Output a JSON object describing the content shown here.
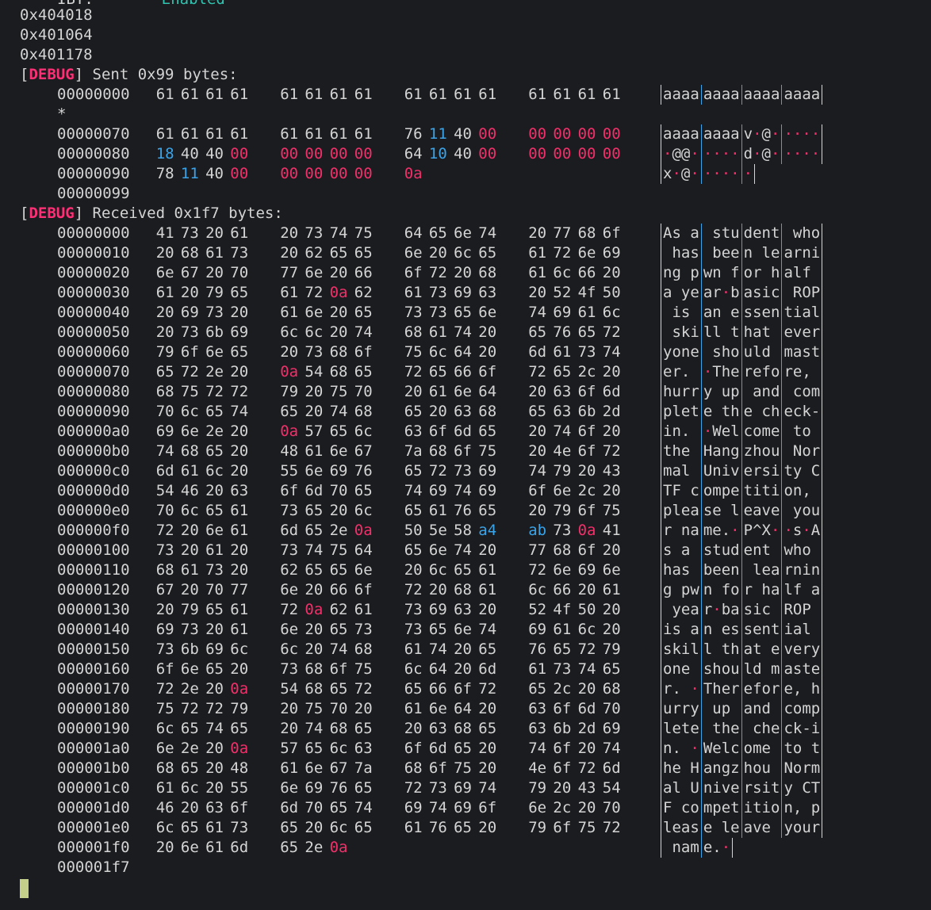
{
  "top_partial": {
    "label": "IBT:",
    "value": "Enabled"
  },
  "addresses": [
    "0x404018",
    "0x401064",
    "0x401178"
  ],
  "sent_block": {
    "tag": "DEBUG",
    "message": " Sent 0x99 bytes:",
    "rows": [
      {
        "off": "00000000",
        "bytes": [
          "61",
          "61",
          "61",
          "61",
          "61",
          "61",
          "61",
          "61",
          "61",
          "61",
          "61",
          "61",
          "61",
          "61",
          "61",
          "61"
        ],
        "ascii": [
          "aaaa",
          "aaaa",
          "aaaa",
          "aaaa"
        ]
      },
      {
        "off": "*",
        "bytes": [],
        "ascii": []
      },
      {
        "off": "00000070",
        "bytes": [
          "61",
          "61",
          "61",
          "61",
          "61",
          "61",
          "61",
          "61",
          "76",
          "11",
          "40",
          "00",
          "00",
          "00",
          "00",
          "00"
        ],
        "ascii": [
          "aaaa",
          "aaaa",
          "v·@·",
          "····"
        ]
      },
      {
        "off": "00000080",
        "bytes": [
          "18",
          "40",
          "40",
          "00",
          "00",
          "00",
          "00",
          "00",
          "64",
          "10",
          "40",
          "00",
          "00",
          "00",
          "00",
          "00"
        ],
        "ascii": [
          "·@@·",
          "····",
          "d·@·",
          "····"
        ]
      },
      {
        "off": "00000090",
        "bytes": [
          "78",
          "11",
          "40",
          "00",
          "00",
          "00",
          "00",
          "00",
          "0a"
        ],
        "ascii": [
          "x·@·",
          "····",
          "·"
        ]
      },
      {
        "off": "00000099",
        "bytes": [],
        "ascii": []
      }
    ]
  },
  "recv_block": {
    "tag": "DEBUG",
    "message": " Received 0x1f7 bytes:",
    "rows": [
      {
        "off": "00000000",
        "bytes": [
          "41",
          "73",
          "20",
          "61",
          "20",
          "73",
          "74",
          "75",
          "64",
          "65",
          "6e",
          "74",
          "20",
          "77",
          "68",
          "6f"
        ],
        "ascii": [
          "As a",
          " stu",
          "dent",
          " who"
        ]
      },
      {
        "off": "00000010",
        "bytes": [
          "20",
          "68",
          "61",
          "73",
          "20",
          "62",
          "65",
          "65",
          "6e",
          "20",
          "6c",
          "65",
          "61",
          "72",
          "6e",
          "69"
        ],
        "ascii": [
          " has",
          " bee",
          "n le",
          "arni"
        ]
      },
      {
        "off": "00000020",
        "bytes": [
          "6e",
          "67",
          "20",
          "70",
          "77",
          "6e",
          "20",
          "66",
          "6f",
          "72",
          "20",
          "68",
          "61",
          "6c",
          "66",
          "20"
        ],
        "ascii": [
          "ng p",
          "wn f",
          "or h",
          "alf "
        ]
      },
      {
        "off": "00000030",
        "bytes": [
          "61",
          "20",
          "79",
          "65",
          "61",
          "72",
          "0a",
          "62",
          "61",
          "73",
          "69",
          "63",
          "20",
          "52",
          "4f",
          "50"
        ],
        "ascii": [
          "a ye",
          "ar·b",
          "asic",
          " ROP"
        ]
      },
      {
        "off": "00000040",
        "bytes": [
          "20",
          "69",
          "73",
          "20",
          "61",
          "6e",
          "20",
          "65",
          "73",
          "73",
          "65",
          "6e",
          "74",
          "69",
          "61",
          "6c"
        ],
        "ascii": [
          " is ",
          "an e",
          "ssen",
          "tial"
        ]
      },
      {
        "off": "00000050",
        "bytes": [
          "20",
          "73",
          "6b",
          "69",
          "6c",
          "6c",
          "20",
          "74",
          "68",
          "61",
          "74",
          "20",
          "65",
          "76",
          "65",
          "72"
        ],
        "ascii": [
          " ski",
          "ll t",
          "hat ",
          "ever"
        ]
      },
      {
        "off": "00000060",
        "bytes": [
          "79",
          "6f",
          "6e",
          "65",
          "20",
          "73",
          "68",
          "6f",
          "75",
          "6c",
          "64",
          "20",
          "6d",
          "61",
          "73",
          "74"
        ],
        "ascii": [
          "yone",
          " sho",
          "uld ",
          "mast"
        ]
      },
      {
        "off": "00000070",
        "bytes": [
          "65",
          "72",
          "2e",
          "20",
          "0a",
          "54",
          "68",
          "65",
          "72",
          "65",
          "66",
          "6f",
          "72",
          "65",
          "2c",
          "20"
        ],
        "ascii": [
          "er. ",
          "·The",
          "refo",
          "re, "
        ]
      },
      {
        "off": "00000080",
        "bytes": [
          "68",
          "75",
          "72",
          "72",
          "79",
          "20",
          "75",
          "70",
          "20",
          "61",
          "6e",
          "64",
          "20",
          "63",
          "6f",
          "6d"
        ],
        "ascii": [
          "hurr",
          "y up",
          " and",
          " com"
        ]
      },
      {
        "off": "00000090",
        "bytes": [
          "70",
          "6c",
          "65",
          "74",
          "65",
          "20",
          "74",
          "68",
          "65",
          "20",
          "63",
          "68",
          "65",
          "63",
          "6b",
          "2d"
        ],
        "ascii": [
          "plet",
          "e th",
          "e ch",
          "eck-"
        ]
      },
      {
        "off": "000000a0",
        "bytes": [
          "69",
          "6e",
          "2e",
          "20",
          "0a",
          "57",
          "65",
          "6c",
          "63",
          "6f",
          "6d",
          "65",
          "20",
          "74",
          "6f",
          "20"
        ],
        "ascii": [
          "in. ",
          "·Wel",
          "come",
          " to "
        ]
      },
      {
        "off": "000000b0",
        "bytes": [
          "74",
          "68",
          "65",
          "20",
          "48",
          "61",
          "6e",
          "67",
          "7a",
          "68",
          "6f",
          "75",
          "20",
          "4e",
          "6f",
          "72"
        ],
        "ascii": [
          "the ",
          "Hang",
          "zhou",
          " Nor"
        ]
      },
      {
        "off": "000000c0",
        "bytes": [
          "6d",
          "61",
          "6c",
          "20",
          "55",
          "6e",
          "69",
          "76",
          "65",
          "72",
          "73",
          "69",
          "74",
          "79",
          "20",
          "43"
        ],
        "ascii": [
          "mal ",
          "Univ",
          "ersi",
          "ty C"
        ]
      },
      {
        "off": "000000d0",
        "bytes": [
          "54",
          "46",
          "20",
          "63",
          "6f",
          "6d",
          "70",
          "65",
          "74",
          "69",
          "74",
          "69",
          "6f",
          "6e",
          "2c",
          "20"
        ],
        "ascii": [
          "TF c",
          "ompe",
          "titi",
          "on, "
        ]
      },
      {
        "off": "000000e0",
        "bytes": [
          "70",
          "6c",
          "65",
          "61",
          "73",
          "65",
          "20",
          "6c",
          "65",
          "61",
          "76",
          "65",
          "20",
          "79",
          "6f",
          "75"
        ],
        "ascii": [
          "plea",
          "se l",
          "eave",
          " you"
        ]
      },
      {
        "off": "000000f0",
        "bytes": [
          "72",
          "20",
          "6e",
          "61",
          "6d",
          "65",
          "2e",
          "0a",
          "50",
          "5e",
          "58",
          "a4",
          "ab",
          "73",
          "0a",
          "41"
        ],
        "ascii": [
          "r na",
          "me.·",
          "P^X·",
          "·s·A"
        ]
      },
      {
        "off": "00000100",
        "bytes": [
          "73",
          "20",
          "61",
          "20",
          "73",
          "74",
          "75",
          "64",
          "65",
          "6e",
          "74",
          "20",
          "77",
          "68",
          "6f",
          "20"
        ],
        "ascii": [
          "s a ",
          "stud",
          "ent ",
          "who "
        ]
      },
      {
        "off": "00000110",
        "bytes": [
          "68",
          "61",
          "73",
          "20",
          "62",
          "65",
          "65",
          "6e",
          "20",
          "6c",
          "65",
          "61",
          "72",
          "6e",
          "69",
          "6e"
        ],
        "ascii": [
          "has ",
          "been",
          " lea",
          "rnin"
        ]
      },
      {
        "off": "00000120",
        "bytes": [
          "67",
          "20",
          "70",
          "77",
          "6e",
          "20",
          "66",
          "6f",
          "72",
          "20",
          "68",
          "61",
          "6c",
          "66",
          "20",
          "61"
        ],
        "ascii": [
          "g pw",
          "n fo",
          "r ha",
          "lf a"
        ]
      },
      {
        "off": "00000130",
        "bytes": [
          "20",
          "79",
          "65",
          "61",
          "72",
          "0a",
          "62",
          "61",
          "73",
          "69",
          "63",
          "20",
          "52",
          "4f",
          "50",
          "20"
        ],
        "ascii": [
          " yea",
          "r·ba",
          "sic ",
          "ROP "
        ]
      },
      {
        "off": "00000140",
        "bytes": [
          "69",
          "73",
          "20",
          "61",
          "6e",
          "20",
          "65",
          "73",
          "73",
          "65",
          "6e",
          "74",
          "69",
          "61",
          "6c",
          "20"
        ],
        "ascii": [
          "is a",
          "n es",
          "sent",
          "ial "
        ]
      },
      {
        "off": "00000150",
        "bytes": [
          "73",
          "6b",
          "69",
          "6c",
          "6c",
          "20",
          "74",
          "68",
          "61",
          "74",
          "20",
          "65",
          "76",
          "65",
          "72",
          "79"
        ],
        "ascii": [
          "skil",
          "l th",
          "at e",
          "very"
        ]
      },
      {
        "off": "00000160",
        "bytes": [
          "6f",
          "6e",
          "65",
          "20",
          "73",
          "68",
          "6f",
          "75",
          "6c",
          "64",
          "20",
          "6d",
          "61",
          "73",
          "74",
          "65"
        ],
        "ascii": [
          "one ",
          "shou",
          "ld m",
          "aste"
        ]
      },
      {
        "off": "00000170",
        "bytes": [
          "72",
          "2e",
          "20",
          "0a",
          "54",
          "68",
          "65",
          "72",
          "65",
          "66",
          "6f",
          "72",
          "65",
          "2c",
          "20",
          "68"
        ],
        "ascii": [
          "r. ·",
          "Ther",
          "efor",
          "e, h"
        ]
      },
      {
        "off": "00000180",
        "bytes": [
          "75",
          "72",
          "72",
          "79",
          "20",
          "75",
          "70",
          "20",
          "61",
          "6e",
          "64",
          "20",
          "63",
          "6f",
          "6d",
          "70"
        ],
        "ascii": [
          "urry",
          " up ",
          "and ",
          "comp"
        ]
      },
      {
        "off": "00000190",
        "bytes": [
          "6c",
          "65",
          "74",
          "65",
          "20",
          "74",
          "68",
          "65",
          "20",
          "63",
          "68",
          "65",
          "63",
          "6b",
          "2d",
          "69"
        ],
        "ascii": [
          "lete",
          " the",
          " che",
          "ck-i"
        ]
      },
      {
        "off": "000001a0",
        "bytes": [
          "6e",
          "2e",
          "20",
          "0a",
          "57",
          "65",
          "6c",
          "63",
          "6f",
          "6d",
          "65",
          "20",
          "74",
          "6f",
          "20",
          "74"
        ],
        "ascii": [
          "n. ·",
          "Welc",
          "ome ",
          "to t"
        ]
      },
      {
        "off": "000001b0",
        "bytes": [
          "68",
          "65",
          "20",
          "48",
          "61",
          "6e",
          "67",
          "7a",
          "68",
          "6f",
          "75",
          "20",
          "4e",
          "6f",
          "72",
          "6d"
        ],
        "ascii": [
          "he H",
          "angz",
          "hou ",
          "Norm"
        ]
      },
      {
        "off": "000001c0",
        "bytes": [
          "61",
          "6c",
          "20",
          "55",
          "6e",
          "69",
          "76",
          "65",
          "72",
          "73",
          "69",
          "74",
          "79",
          "20",
          "43",
          "54"
        ],
        "ascii": [
          "al U",
          "nive",
          "rsit",
          "y CT"
        ]
      },
      {
        "off": "000001d0",
        "bytes": [
          "46",
          "20",
          "63",
          "6f",
          "6d",
          "70",
          "65",
          "74",
          "69",
          "74",
          "69",
          "6f",
          "6e",
          "2c",
          "20",
          "70"
        ],
        "ascii": [
          "F co",
          "mpet",
          "itio",
          "n, p"
        ]
      },
      {
        "off": "000001e0",
        "bytes": [
          "6c",
          "65",
          "61",
          "73",
          "65",
          "20",
          "6c",
          "65",
          "61",
          "76",
          "65",
          "20",
          "79",
          "6f",
          "75",
          "72"
        ],
        "ascii": [
          "leas",
          "e le",
          "ave ",
          "your"
        ]
      },
      {
        "off": "000001f0",
        "bytes": [
          "20",
          "6e",
          "61",
          "6d",
          "65",
          "2e",
          "0a"
        ],
        "ascii": [
          " nam",
          "e.·"
        ]
      },
      {
        "off": "000001f7",
        "bytes": [],
        "ascii": []
      }
    ]
  },
  "colors": {
    "background": "#1b1c1f",
    "text": "#d4d4d4",
    "null_byte": "#f0306a",
    "nonprint_byte": "#3ba3e8",
    "debug_tag": "#ff2f75",
    "cursor": "#c4cf8a"
  }
}
